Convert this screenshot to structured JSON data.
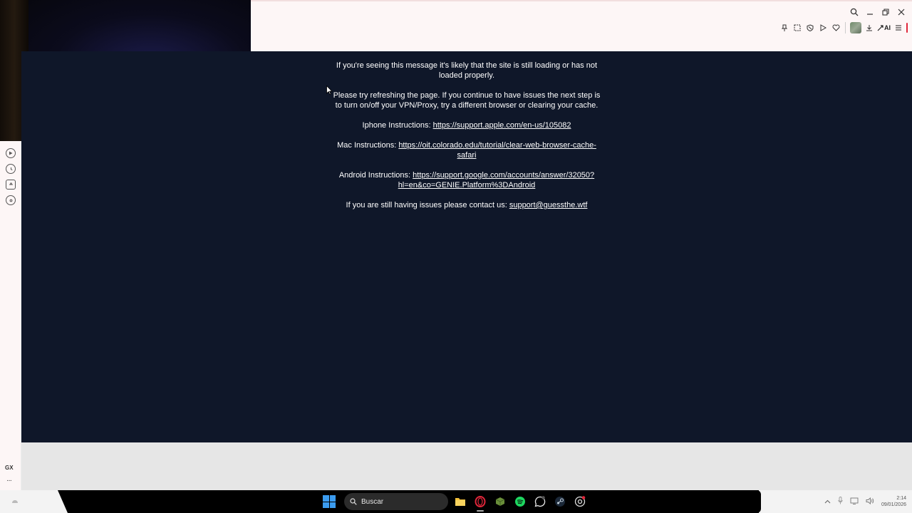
{
  "message": {
    "intro": "If you're seeing this message it's likely that the site is still loading or has not loaded properly.",
    "advice": "Please try refreshing the page. If you continue to have issues the next step is to turn on/off your VPN/Proxy, try a different browser or clearing your cache.",
    "iphone_label": "Iphone Instructions:",
    "iphone_link": "https://support.apple.com/en-us/105082",
    "mac_label": "Mac Instructions:",
    "mac_link": "https://oit.colorado.edu/tutorial/clear-web-browser-cache-safari",
    "android_label": "Android Instructions:",
    "android_link": "https://support.google.com/accounts/answer/32050?hl=en&co=GENIE.Platform%3DAndroid",
    "contact_label": "If you are still having issues please contact us:",
    "contact_link": "support@guessthe.wtf"
  },
  "browser": {
    "ai_label": "AI"
  },
  "sidebar": {
    "gx_label": "GX",
    "more_label": "···"
  },
  "taskbar": {
    "search_placeholder": "Buscar",
    "time": "2:14",
    "date": "09/01/2026"
  },
  "colors": {
    "page_background": "#0f1729",
    "text": "#ffffff",
    "chrome_background": "#fdf6f6",
    "accent": "#e0263a"
  },
  "icons": {
    "sidebar": [
      "player-icon",
      "history-icon",
      "extensions-icon",
      "settings-icon"
    ],
    "toolbar": [
      "pin-icon",
      "snapshot-icon",
      "shield-icon",
      "play-icon",
      "heart-icon",
      "download-icon",
      "aria-icon",
      "menu-icon"
    ],
    "taskbar": [
      "windows-icon",
      "file-explorer-icon",
      "opera-gx-icon",
      "minecraft-icon",
      "spotify-icon",
      "whatsapp-icon",
      "steam-icon",
      "chrome-icon"
    ]
  }
}
